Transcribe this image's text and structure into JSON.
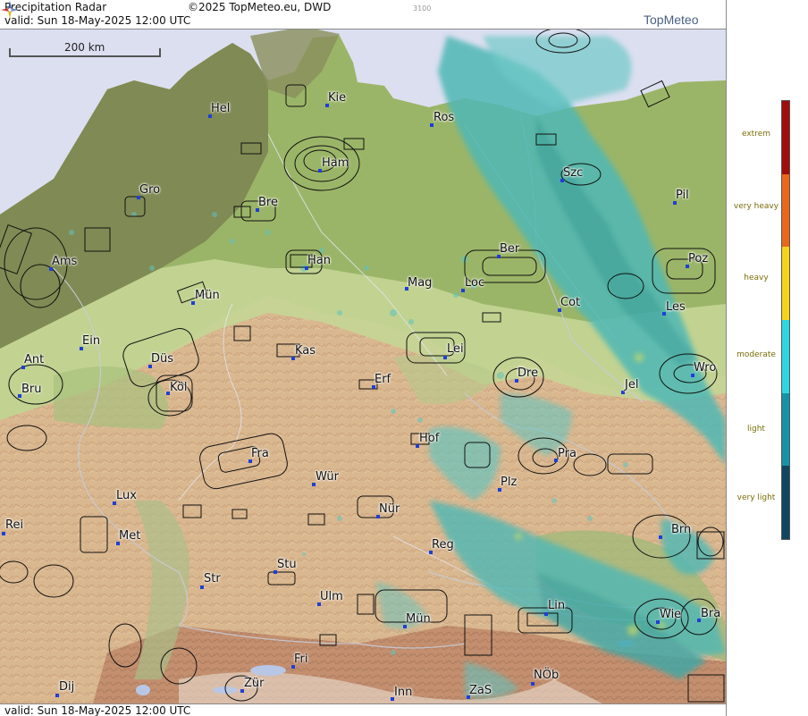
{
  "header": {
    "title": "Precipitation Radar",
    "copyright": "©2025 TopMeteo.eu, DWD",
    "valid": "valid:  Sun  18-May-2025 12:00 UTC",
    "code": "3100",
    "brand": "TopMeteo"
  },
  "footer": {
    "valid": "valid:  Sun  18-May-2025 12:00 UTC"
  },
  "scale": {
    "label": "200 km"
  },
  "cities": [
    {
      "name": "Kie"
    },
    {
      "name": "Hel"
    },
    {
      "name": "Ros"
    },
    {
      "name": "Ham"
    },
    {
      "name": "Szc"
    },
    {
      "name": "Gro"
    },
    {
      "name": "Bre"
    },
    {
      "name": "Pil"
    },
    {
      "name": "Ber"
    },
    {
      "name": "Ams"
    },
    {
      "name": "Han"
    },
    {
      "name": "Poz"
    },
    {
      "name": "Mün"
    },
    {
      "name": "Mag"
    },
    {
      "name": "Loc"
    },
    {
      "name": "Cot"
    },
    {
      "name": "Les"
    },
    {
      "name": "Ein"
    },
    {
      "name": "Kas"
    },
    {
      "name": "Lei"
    },
    {
      "name": "Ant"
    },
    {
      "name": "Düs"
    },
    {
      "name": "Wro"
    },
    {
      "name": "Dre"
    },
    {
      "name": "Bru"
    },
    {
      "name": "Köl"
    },
    {
      "name": "Erf"
    },
    {
      "name": "Jel"
    },
    {
      "name": "Hof"
    },
    {
      "name": "Fra"
    },
    {
      "name": "Pra"
    },
    {
      "name": "Wür"
    },
    {
      "name": "Plz"
    },
    {
      "name": "Lux"
    },
    {
      "name": "Nür"
    },
    {
      "name": "Rei"
    },
    {
      "name": "Met"
    },
    {
      "name": "Reg"
    },
    {
      "name": "Brn"
    },
    {
      "name": "Stu"
    },
    {
      "name": "Str"
    },
    {
      "name": "Ulm"
    },
    {
      "name": "Lin"
    },
    {
      "name": "Mün"
    },
    {
      "name": "Wie"
    },
    {
      "name": "Bra"
    },
    {
      "name": "Fri"
    },
    {
      "name": "Dij"
    },
    {
      "name": "Zür"
    },
    {
      "name": "NÖb"
    },
    {
      "name": "Inn"
    },
    {
      "name": "ZaS"
    }
  ],
  "legend": {
    "levels": [
      {
        "label": "extrem",
        "color": "#a00d0d"
      },
      {
        "label": "very heavy",
        "color": "#e8681a"
      },
      {
        "label": "heavy",
        "color": "#f5d51a"
      },
      {
        "label": "moderate",
        "color": "#2ed7e0"
      },
      {
        "label": "light",
        "color": "#1593a6"
      },
      {
        "label": "very light",
        "color": "#0f4761"
      }
    ]
  },
  "colors": {
    "sea": "#dcdff0",
    "lowland_green": "#93b063",
    "dark_lowland": "#6f7c4a",
    "upland": "#d9bf93",
    "mountain": "#c89a77",
    "radar_teal": "#4fb8b5"
  }
}
